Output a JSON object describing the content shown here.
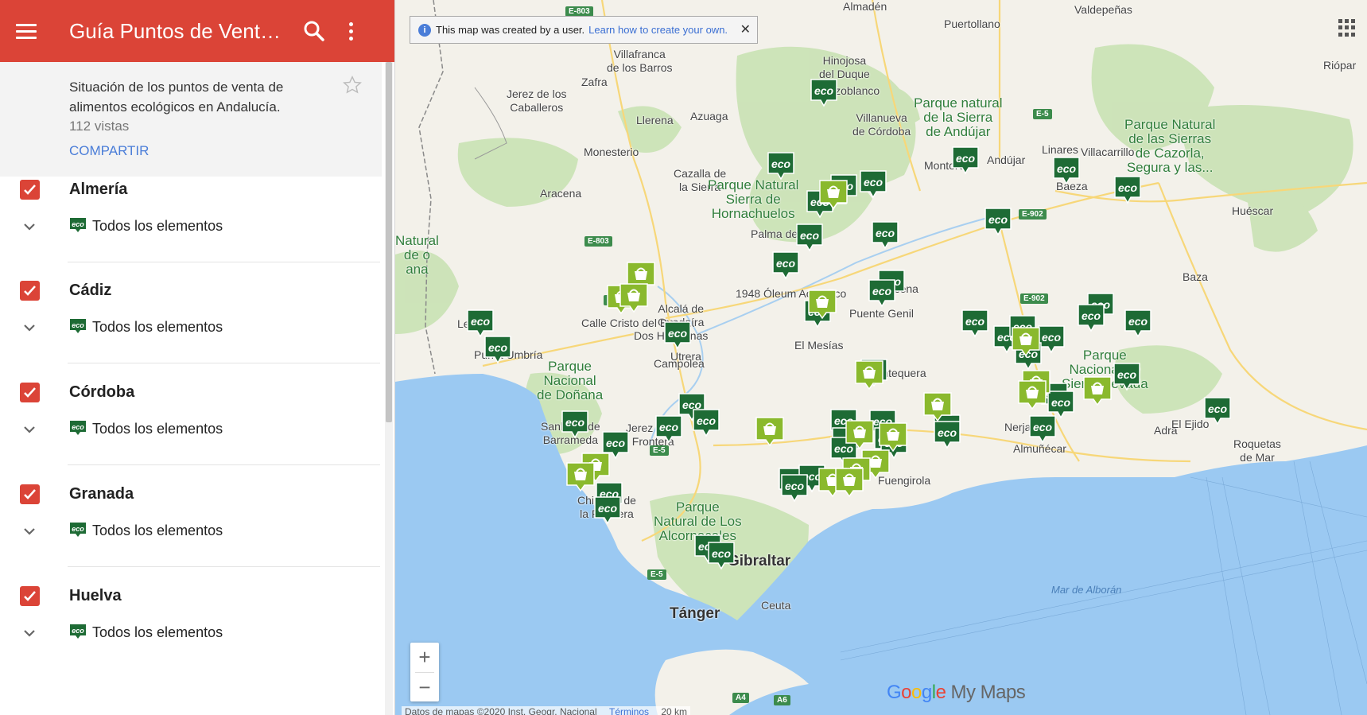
{
  "header": {
    "title": "Guía Puntos de Venta Andalucía"
  },
  "info": {
    "description": "Situación de los puntos de venta de alimentos ecológicos en Andalucía.",
    "views": "112 vistas",
    "share_label": "COMPARTIR"
  },
  "layers": [
    {
      "name": "Almería",
      "items_label": "Todos los elementos"
    },
    {
      "name": "Cádiz",
      "items_label": "Todos los elementos"
    },
    {
      "name": "Córdoba",
      "items_label": "Todos los elementos"
    },
    {
      "name": "Granada",
      "items_label": "Todos los elementos"
    },
    {
      "name": "Huelva",
      "items_label": "Todos los elementos"
    }
  ],
  "notice": {
    "text": "This map was created by a user.",
    "link": "Learn how to create your own."
  },
  "map_labels": {
    "villafranca": "Villafranca\nde los Barros",
    "zafra": "Zafra",
    "jerez_caballeros": "Jerez de los\nCaballeros",
    "llerena": "Llerena",
    "azuaga": "Azuaga",
    "monesterio": "Monesterio",
    "cazalla": "Cazalla de\nla Sierra",
    "aracena": "Aracena",
    "almaden": "Almadén",
    "puertollano": "Puertollano",
    "valdepenas": "Valdepeñas",
    "hinojosa": "Hinojosa\ndel Duque",
    "pozoblanco": "Pozoblanco",
    "villanueva": "Villanueva\nde Córdoba",
    "montoro": "Montoro",
    "andujar": "Andújar",
    "linares": "Linares",
    "villacarrillo": "Villacarrillo",
    "baeza": "Baeza",
    "huescar": "Huéscar",
    "riopar": "Riópar",
    "palma": "Palma del Río",
    "alcala": "Alcalá de\nGuadaíra",
    "dos_hermanas": "Dos Hermanas",
    "utrera": "Utrera",
    "lepe": "Lepe",
    "punta_umbria": "Punta Umbría",
    "sanlucar": "Sanlúcar de\nBarrameda",
    "jerez": "Jerez de la\nFrontera",
    "chiclana": "Chiclana de\nla Frontera",
    "antequera": "Antequera",
    "nerja": "Nerja",
    "almunecar": "Almuñécar",
    "adra": "Adra",
    "el_ejido": "El Ejido",
    "roquetas": "Roquetas\nde Mar",
    "fuengirola": "Fuengirola",
    "gibraltar": "Gibraltar",
    "tanger": "Tánger",
    "ceuta": "Ceuta",
    "baza": "Baza",
    "puente_genil": "Puente Genil",
    "lucena": "Lucena",
    "oleum": "1948 Óleum Aove Eco",
    "el_mesias": "El Mesías",
    "calle_cristo": "Calle Cristo del Buen...",
    "campolea": "Campolea",
    "mar_alboran": "Mar de Alborán"
  },
  "parks": {
    "andujar": "Parque natural\nde la Sierra\nde Andújar",
    "cazorla": "Parque Natural\nde las Sierras\nde Cazorla,\nSegura y las...",
    "hornachuelos": "Parque Natural\nSierra de\nHornachuelos",
    "donana": "Parque\nNacional\nde Doñana",
    "alcornocales": "Parque\nNatural de Los\nAlcornocales",
    "sierra_nevada": "Parque\nNacional de\nSierra Nevada",
    "natural_lado": "Natural\nde o\nana"
  },
  "roads": {
    "e803a": "E-803",
    "e803b": "E-803",
    "e803c": "E-803",
    "e5a": "E-5",
    "e5b": "E-5",
    "e5c": "E-5",
    "e902a": "E-902",
    "e902b": "E-902",
    "a4": "A4",
    "a6": "A6"
  },
  "brand": {
    "g1": "G",
    "g2": "o",
    "g3": "o",
    "g4": "g",
    "g5": "l",
    "g6": "e",
    "suffix": "My Maps"
  },
  "footer": {
    "data": "Datos de mapas ©2020 Inst. Geogr. Nacional",
    "terms": "Términos",
    "scale": "20 km"
  },
  "zoom": {
    "in": "+",
    "out": "−"
  },
  "pins": {
    "eco_text": "eco",
    "eco_color": "#1e6b35",
    "shop_color": "#8ab92d"
  }
}
